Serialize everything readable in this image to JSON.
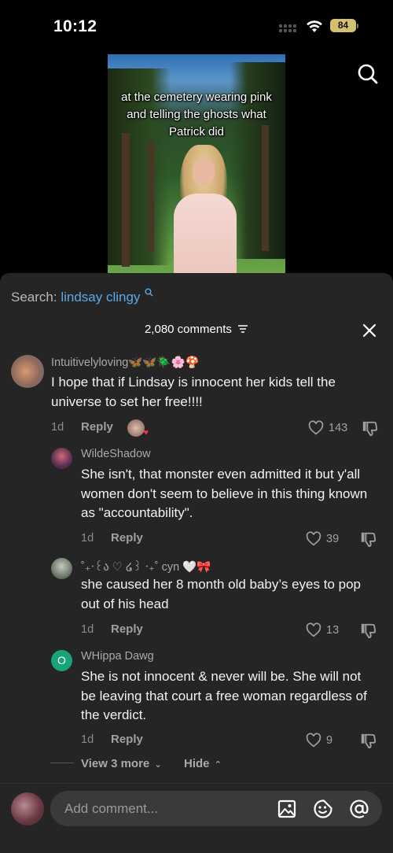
{
  "status": {
    "time": "10:12",
    "battery": "84"
  },
  "video": {
    "caption": "at the cemetery wearing pink and telling the ghosts what Patrick did"
  },
  "comments_panel": {
    "search_label": "Search:",
    "search_query": "lindsay clingy",
    "count_label": "2,080 comments",
    "comments": [
      {
        "user": "Intuitivelyloving🦋🦋🪲🌸🍄",
        "text": "I hope that if Lindsay is innocent her kids tell the universe to set her free!!!!",
        "age": "1d",
        "reply": "Reply",
        "likes": "143"
      },
      {
        "user": "WildeShadow",
        "text": "She isn't, that monster even admitted it but y'all women don't seem to believe in this thing known as \"accountability\".",
        "age": "1d",
        "reply": "Reply",
        "likes": "39"
      },
      {
        "user": "˚₊‧꒰ა ♡ ໒꒱ ‧₊˚ cyn 🤍🎀",
        "text": "she caused her 8 month old baby’s eyes to pop out of his head",
        "age": "1d",
        "reply": "Reply",
        "likes": "13"
      },
      {
        "user": "WHippa Dawg",
        "avatar_letter": "O",
        "text": "She is not innocent & never will be. She will not be leaving that court a free woman regardless of the verdict.",
        "age": "1d",
        "reply": "Reply",
        "likes": "9"
      }
    ],
    "view_more": "View 3 more",
    "hide": "Hide"
  },
  "input": {
    "placeholder": "Add comment..."
  },
  "colors": {
    "panel_bg": "#252525",
    "accent_link": "#5aa9e8",
    "avatar_green": "#1aa37a"
  }
}
